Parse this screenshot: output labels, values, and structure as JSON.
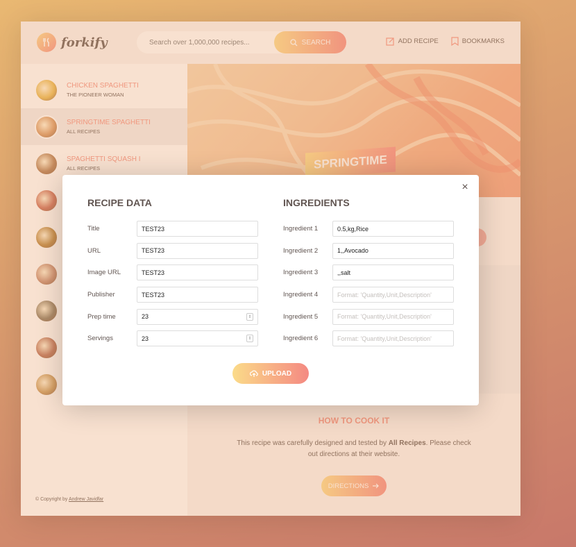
{
  "header": {
    "logo_text": "forkify",
    "search_placeholder": "Search over 1,000,000 recipes...",
    "search_button": "SEARCH",
    "nav": {
      "add_recipe": "ADD RECIPE",
      "bookmarks": "BOOKMARKS"
    }
  },
  "sidebar": {
    "results": [
      {
        "title": "CHICKEN SPAGHETTI",
        "publisher": "THE PIONEER WOMAN",
        "color": "#e8b84a"
      },
      {
        "title": "SPRINGTIME SPAGHETTI",
        "publisher": "ALL RECIPES",
        "color": "#d6955f"
      },
      {
        "title": "SPAGHETTI SQUASH I",
        "publisher": "ALL RECIPES",
        "color": "#b07a4f"
      },
      {
        "title": "",
        "publisher": "",
        "color": "#cc6a55"
      },
      {
        "title": "",
        "publisher": "",
        "color": "#b8843a"
      },
      {
        "title": "",
        "publisher": "",
        "color": "#c58a70"
      },
      {
        "title": "",
        "publisher": "",
        "color": "#8a7a60"
      },
      {
        "title": "",
        "publisher": "",
        "color": "#b86d55"
      },
      {
        "title": "",
        "publisher": "",
        "color": "#c99a5a"
      }
    ],
    "copyright_prefix": "© Copyright by",
    "copyright_author": "Andrew Javidfar"
  },
  "main": {
    "hero_title": "SPRINGTIME",
    "how_title": "HOW TO COOK IT",
    "how_text_1": "This recipe was carefully designed and tested by",
    "how_publisher": "All Recipes",
    "how_text_2": ". Please check out directions at their website.",
    "directions_button": "DIRECTIONS"
  },
  "modal": {
    "close": "×",
    "recipe_heading": "RECIPE DATA",
    "ingredients_heading": "INGREDIENTS",
    "recipe_fields": [
      {
        "label": "Title",
        "value": "TEST23"
      },
      {
        "label": "URL",
        "value": "TEST23"
      },
      {
        "label": "Image URL",
        "value": "TEST23"
      },
      {
        "label": "Publisher",
        "value": "TEST23"
      },
      {
        "label": "Prep time",
        "value": "23"
      },
      {
        "label": "Servings",
        "value": "23"
      }
    ],
    "ingredient_fields": [
      {
        "label": "Ingredient 1",
        "value": "0.5,kg,Rice"
      },
      {
        "label": "Ingredient 2",
        "value": "1,,Avocado"
      },
      {
        "label": "Ingredient 3",
        "value": ",,salt"
      },
      {
        "label": "Ingredient 4",
        "value": "",
        "placeholder": "Format: 'Quantity,Unit,Description'"
      },
      {
        "label": "Ingredient 5",
        "value": "",
        "placeholder": "Format: 'Quantity,Unit,Description'"
      },
      {
        "label": "Ingredient 6",
        "value": "",
        "placeholder": "Format: 'Quantity,Unit,Description'"
      }
    ],
    "upload_button": "UPLOAD"
  }
}
